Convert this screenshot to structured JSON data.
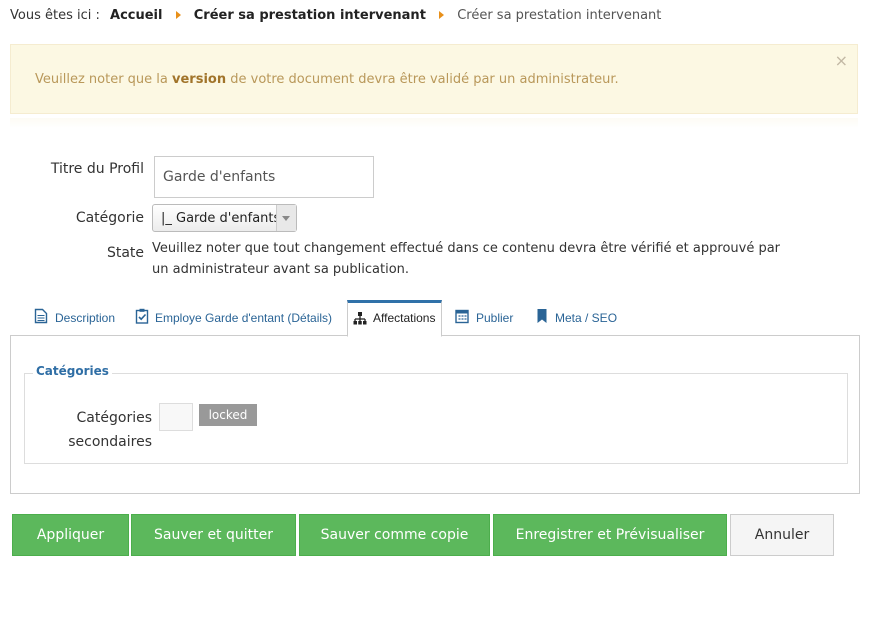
{
  "breadcrumb": {
    "prefix": "Vous êtes ici :",
    "items": [
      "Accueil",
      "Créer sa prestation intervenant",
      "Créer sa prestation intervenant"
    ]
  },
  "alert": {
    "before": "Veuillez noter que la ",
    "emphasis": "version",
    "after": " de votre document devra être validé par un administrateur.",
    "close": "×"
  },
  "form": {
    "title_label": "Titre du Profil",
    "title_value": "Garde d'enfants",
    "category_label": "Catégorie",
    "category_value": "|_ Garde d'enfants",
    "state_label": "State",
    "state_text": "Veuillez noter que tout changement effectué dans ce contenu devra être vérifié et approuvé par un administrateur avant sa publication."
  },
  "tabs": [
    {
      "label": "Description",
      "icon": "document-icon"
    },
    {
      "label": "Employe Garde d'entant (Détails)",
      "icon": "clipboard-check-icon"
    },
    {
      "label": "Affectations",
      "icon": "sitemap-icon",
      "active": true
    },
    {
      "label": "Publier",
      "icon": "calendar-icon"
    },
    {
      "label": "Meta / SEO",
      "icon": "bookmark-icon"
    }
  ],
  "panel": {
    "legend": "Catégories",
    "secondary_label": "Catégories secondaires",
    "locked_badge": "locked"
  },
  "buttons": {
    "apply": "Appliquer",
    "save_close": "Sauver et quitter",
    "save_copy": "Sauver comme copie",
    "save_preview": "Enregistrer et Prévisualiser",
    "cancel": "Annuler"
  },
  "colors": {
    "accent": "#3071a9",
    "success": "#5cb85c",
    "warning_bg": "#fcf8e3",
    "breadcrumb_arrow": "#e8901a"
  }
}
